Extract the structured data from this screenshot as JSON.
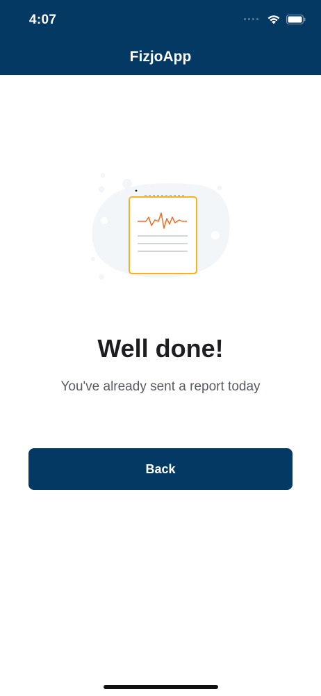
{
  "status_bar": {
    "time": "4:07"
  },
  "header": {
    "title": "FizjoApp"
  },
  "content": {
    "illustration_icon": "report-with-heartbeat-illustration",
    "headline": "Well done!",
    "message": "You've already sent a report today"
  },
  "actions": {
    "back_label": "Back"
  },
  "colors": {
    "primary": "#033963",
    "accent_orange": "#f26b22",
    "accent_yellow": "#f7b21e",
    "text_dark": "#1d1d1f",
    "text_muted": "#555b63"
  }
}
